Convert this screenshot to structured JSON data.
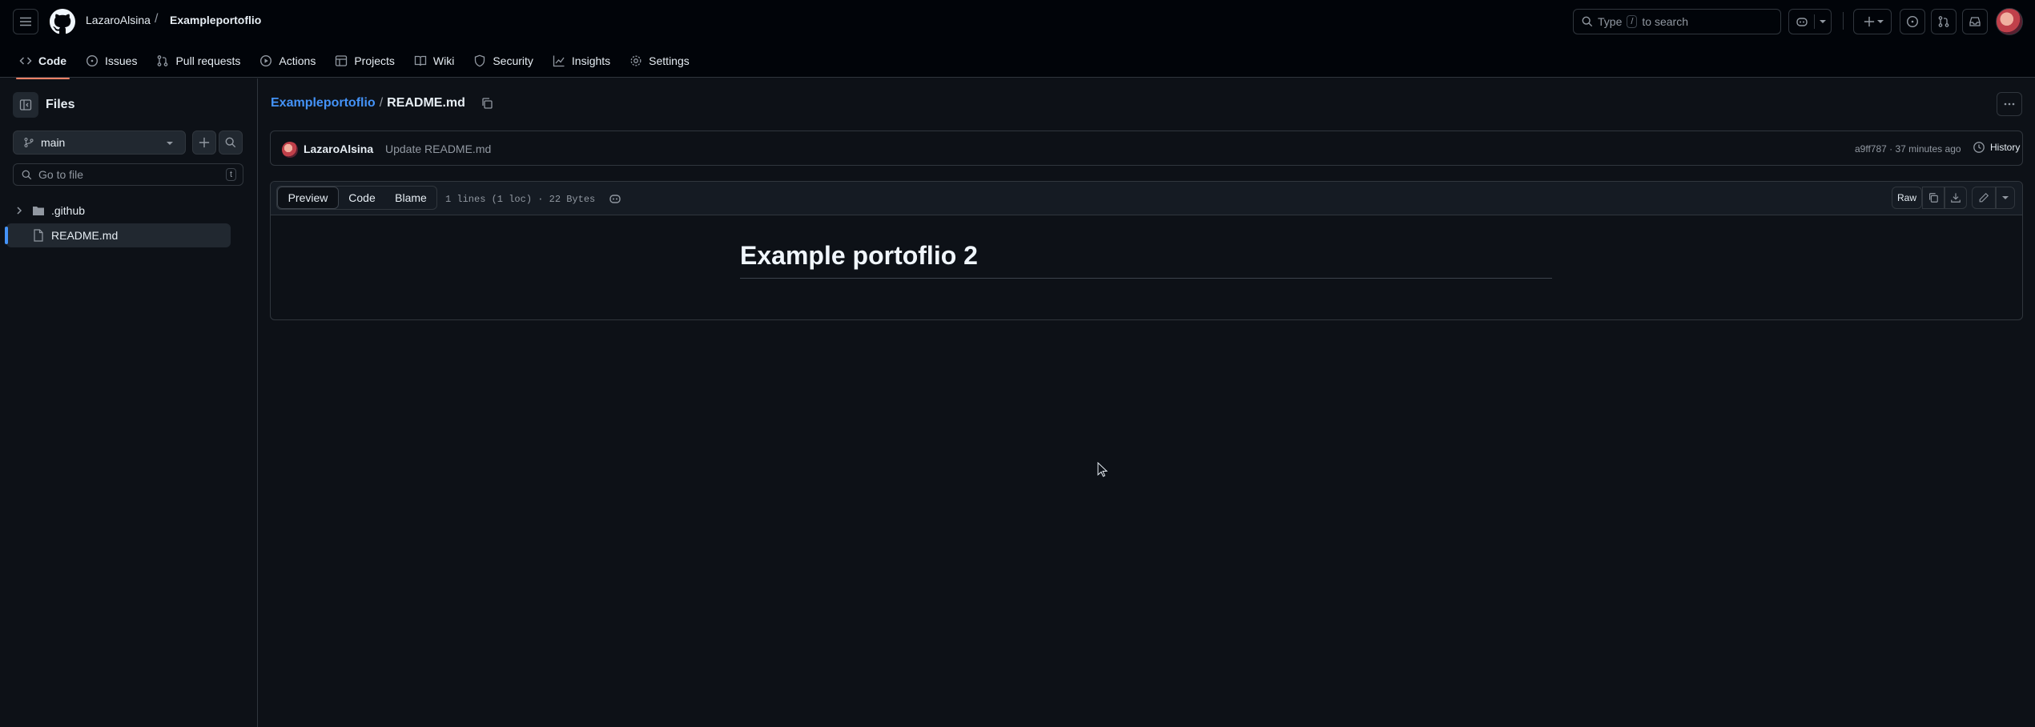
{
  "header": {
    "owner": "LazaroAlsina",
    "separator": "/",
    "repo": "Exampleportoflio",
    "search_prefix": "Type",
    "search_key": "/",
    "search_suffix": "to search"
  },
  "tabs": [
    {
      "label": "Code",
      "icon": "code-icon"
    },
    {
      "label": "Issues",
      "icon": "issue-opened-icon"
    },
    {
      "label": "Pull requests",
      "icon": "git-pull-request-icon"
    },
    {
      "label": "Actions",
      "icon": "play-icon"
    },
    {
      "label": "Projects",
      "icon": "table-icon"
    },
    {
      "label": "Wiki",
      "icon": "book-icon"
    },
    {
      "label": "Security",
      "icon": "shield-icon"
    },
    {
      "label": "Insights",
      "icon": "graph-icon"
    },
    {
      "label": "Settings",
      "icon": "gear-icon"
    }
  ],
  "sidebar": {
    "title": "Files",
    "branch": "main",
    "goto_placeholder": "Go to file",
    "goto_shortcut": "t",
    "tree": [
      {
        "name": ".github",
        "type": "folder"
      },
      {
        "name": "README.md",
        "type": "file",
        "selected": true
      }
    ]
  },
  "file": {
    "breadcrumb_repo": "Exampleportoflio",
    "breadcrumb_sep": "/",
    "breadcrumb_file": "README.md",
    "commit_author": "LazaroAlsina",
    "commit_message": "Update README.md",
    "commit_meta": "a9ff787 · 37 minutes ago",
    "history_label": "History",
    "view_tabs": [
      "Preview",
      "Code",
      "Blame"
    ],
    "file_info": "1 lines (1 loc) · 22 Bytes",
    "raw_label": "Raw",
    "readme_heading": "Example portoflio 2"
  },
  "colors": {
    "accent_link": "#4493f8",
    "tab_underline": "#f78166",
    "background": "#0d1117",
    "header_bg": "#010409",
    "border": "#30363d"
  }
}
